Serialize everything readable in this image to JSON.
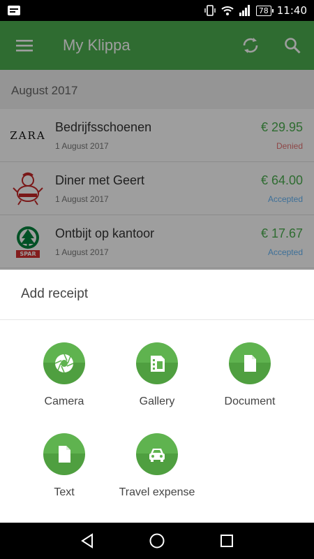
{
  "status_bar": {
    "time": "11:40",
    "battery": "78"
  },
  "app_bar": {
    "title": "My Klippa"
  },
  "list": {
    "month": "August 2017",
    "receipts": [
      {
        "logo": "ZARA",
        "name": "Bedrijfsschoenen",
        "date": "1 August 2017",
        "amount": "€ 29.95",
        "status": "Denied"
      },
      {
        "logo": "sumo-logo",
        "name": "Diner met Geert",
        "date": "1 August 2017",
        "amount": "€ 64.00",
        "status": "Accepted"
      },
      {
        "logo": "SPAR",
        "name": "Ontbijt op kantoor",
        "date": "1 August 2017",
        "amount": "€ 17.67",
        "status": "Accepted"
      }
    ]
  },
  "sheet": {
    "title": "Add receipt",
    "options": [
      {
        "label": "Camera",
        "icon": "camera-icon"
      },
      {
        "label": "Gallery",
        "icon": "gallery-icon"
      },
      {
        "label": "Document",
        "icon": "document-icon"
      },
      {
        "label": "Text",
        "icon": "text-icon"
      },
      {
        "label": "Travel expense",
        "icon": "car-icon"
      }
    ]
  },
  "colors": {
    "brand": "#4caf50",
    "denied": "#e57373",
    "accepted": "#64b5f6"
  }
}
